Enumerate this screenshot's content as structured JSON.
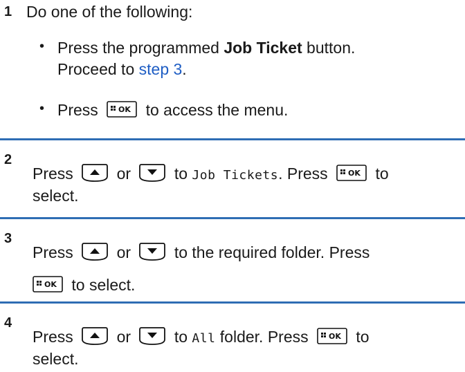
{
  "steps": [
    {
      "number": "1",
      "intro": "Do one of the following:",
      "bullet1": {
        "prefix": "Press the programmed ",
        "bold": "Job Ticket",
        "suffix": " button.",
        "line2_prefix": "Proceed to ",
        "link": "step 3",
        "line2_suffix": "."
      },
      "bullet2": {
        "prefix": "Press",
        "suffix": "to access the menu."
      }
    },
    {
      "number": "2",
      "press": "Press",
      "or": "or",
      "to": "to",
      "target": "Job Tickets",
      "mid": ". Press",
      "end": "to",
      "line2": "select."
    },
    {
      "number": "3",
      "press": "Press",
      "or": "or",
      "rest": "to the required folder. Press",
      "line2": "to select."
    },
    {
      "number": "4",
      "press": "Press",
      "or": "or",
      "to": "to",
      "target": "All",
      "mid": " folder. Press",
      "end": "to",
      "line2": "select."
    }
  ],
  "icons": {
    "ok_key": "menu-ok-key-icon",
    "up_key": "up-arrow-key-icon",
    "down_key": "down-arrow-key-icon",
    "ok_label": "OK"
  },
  "colors": {
    "divider": "#2e6db4",
    "link": "#1f5ec4"
  }
}
